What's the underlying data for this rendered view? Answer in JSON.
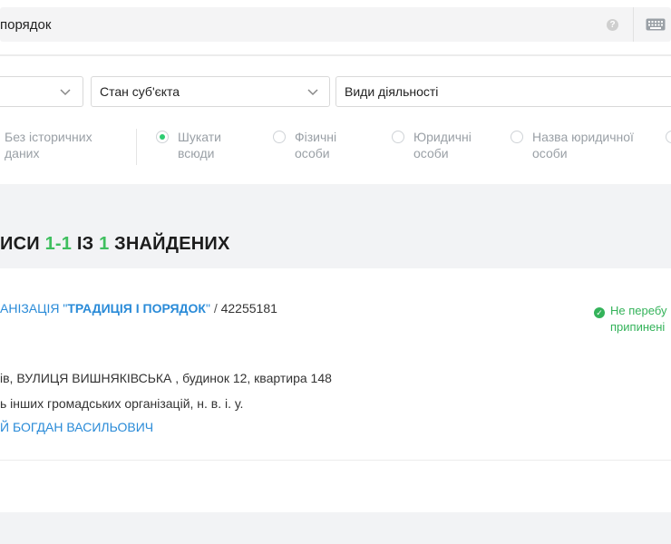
{
  "search": {
    "query": "порядок",
    "help_glyph": "?",
    "help_icon": "question-circle-icon",
    "keyboard_icon": "keyboard-icon"
  },
  "filters_row": {
    "first_select": "",
    "subject_state": "Стан суб'єкта",
    "activities": "Види діяльності"
  },
  "options": {
    "no_history_line1": "Без історичних",
    "no_history_line2": "даних",
    "search_everywhere_line1": "Шукати",
    "search_everywhere_line2": "всюди",
    "individuals_line1": "Фізичні",
    "individuals_line2": "особи",
    "legal_line1": "Юридичні",
    "legal_line2": "особи",
    "legal_name_line1": "Назва юридичної",
    "legal_name_line2": "особи",
    "selected": "search_everywhere"
  },
  "results": {
    "prefix": "ИСИ ",
    "range": "1-1",
    "mid": " ІЗ ",
    "count": "1",
    "suffix": " ЗНАЙДЕНИХ"
  },
  "card": {
    "org_prefix": "АНІЗАЦІЯ \"",
    "org_name_bold": "ТРАДИЦІЯ І ПОРЯДОК",
    "org_suffix": "\"",
    "slash": " / ",
    "code": "42255181",
    "status_line1": "Не перебу",
    "status_line2": "припинені",
    "address": "ів, ВУЛИЦЯ ВИШНЯКІВСЬКА , будинок 12, квартира 148",
    "activity": "ь інших громадських організацій, н. в. і. у.",
    "head": "Й БОГДАН ВАСИЛЬОВИЧ"
  },
  "colors": {
    "accent_green": "#3fbf5f",
    "link_blue": "#2a8bd8",
    "band_gray": "#f2f3f5"
  }
}
